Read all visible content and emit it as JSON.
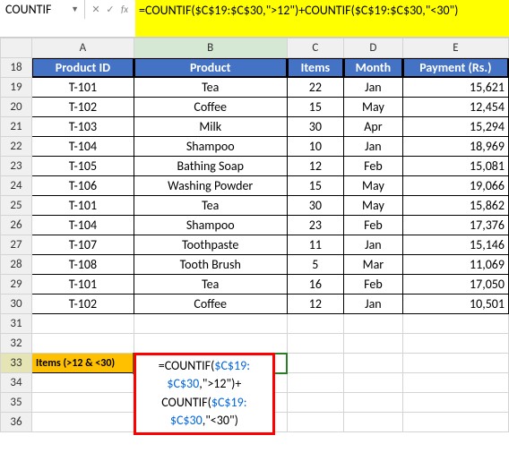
{
  "nameBox": "COUNTIF",
  "formulaBarText": "=COUNTIF($C$19:$C$30,\">12\")+COUNTIF($C$19:$C$30,\"<30\")",
  "colHeaders": [
    "A",
    "B",
    "C",
    "D",
    "E"
  ],
  "rowStart": 18,
  "rowEnd": 36,
  "table": {
    "headers": [
      "Product ID",
      "Product",
      "Items",
      "Month",
      "Payment (Rs.)"
    ],
    "rows": [
      {
        "id": "T-101",
        "product": "Tea",
        "items": "22",
        "month": "Jan",
        "payment": "15,621"
      },
      {
        "id": "T-102",
        "product": "Coffee",
        "items": "15",
        "month": "May",
        "payment": "12,454"
      },
      {
        "id": "T-103",
        "product": "Milk",
        "items": "30",
        "month": "Apr",
        "payment": "15,294"
      },
      {
        "id": "T-104",
        "product": "Shampoo",
        "items": "10",
        "month": "Jan",
        "payment": "18,969"
      },
      {
        "id": "T-105",
        "product": "Bathing Soap",
        "items": "12",
        "month": "Feb",
        "payment": "15,081"
      },
      {
        "id": "T-106",
        "product": "Washing Powder",
        "items": "15",
        "month": "May",
        "payment": "19,066"
      },
      {
        "id": "T-101",
        "product": "Tea",
        "items": "30",
        "month": "May",
        "payment": "15,862"
      },
      {
        "id": "T-104",
        "product": "Shampoo",
        "items": "23",
        "month": "Feb",
        "payment": "17,376"
      },
      {
        "id": "T-107",
        "product": "Toothpaste",
        "items": "11",
        "month": "Jan",
        "payment": "15,146"
      },
      {
        "id": "T-108",
        "product": "Tooth Brush",
        "items": "5",
        "month": "Mar",
        "payment": "11,069"
      },
      {
        "id": "T-101",
        "product": "Tea",
        "items": "16",
        "month": "Feb",
        "payment": "17,050"
      },
      {
        "id": "T-102",
        "product": "Coffee",
        "items": "12",
        "month": "Jan",
        "payment": "10,501"
      }
    ]
  },
  "label": "Items (>12 & <30)",
  "formulaDisplay": {
    "p1": "=COUNTIF(",
    "p2": "$C$19:$C$30",
    "p3": ",\">12\")+COUNTIF(",
    "p4": "$C$19:$C$30",
    "p5": ",\"<30\")"
  },
  "chart_data": {
    "type": "table",
    "title": "",
    "columns": [
      "Product ID",
      "Product",
      "Items",
      "Month",
      "Payment (Rs.)"
    ],
    "rows": [
      [
        "T-101",
        "Tea",
        22,
        "Jan",
        15621
      ],
      [
        "T-102",
        "Coffee",
        15,
        "May",
        12454
      ],
      [
        "T-103",
        "Milk",
        30,
        "Apr",
        15294
      ],
      [
        "T-104",
        "Shampoo",
        10,
        "Jan",
        18969
      ],
      [
        "T-105",
        "Bathing Soap",
        12,
        "Feb",
        15081
      ],
      [
        "T-106",
        "Washing Powder",
        15,
        "May",
        19066
      ],
      [
        "T-101",
        "Tea",
        30,
        "May",
        15862
      ],
      [
        "T-104",
        "Shampoo",
        23,
        "Feb",
        17376
      ],
      [
        "T-107",
        "Toothpaste",
        11,
        "Jan",
        15146
      ],
      [
        "T-108",
        "Tooth Brush",
        5,
        "Mar",
        11069
      ],
      [
        "T-101",
        "Tea",
        16,
        "Feb",
        17050
      ],
      [
        "T-102",
        "Coffee",
        12,
        "Jan",
        10501
      ]
    ]
  }
}
